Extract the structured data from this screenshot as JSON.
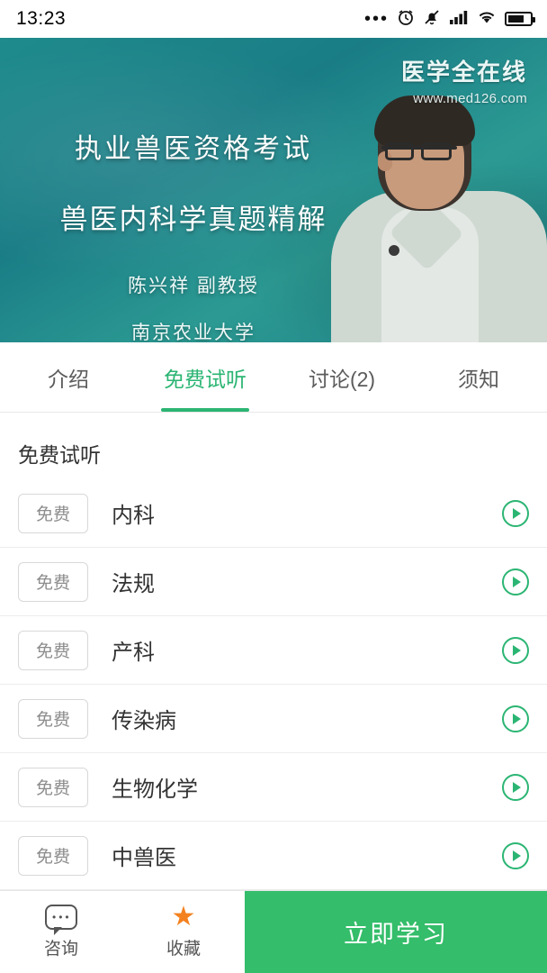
{
  "status_bar": {
    "time": "13:23",
    "icons": [
      "more-dots",
      "alarm-icon",
      "mute-bell-icon",
      "signal-icon",
      "wifi-icon",
      "battery-icon"
    ]
  },
  "hero": {
    "watermark_main": "医学全在线",
    "watermark_url": "www.med126.com",
    "title_line1": "执业兽医资格考试",
    "title_line2": "兽医内科学真题精解",
    "lecturer": "陈兴祥  副教授",
    "school": "南京农业大学"
  },
  "tabs": [
    {
      "label": "介绍",
      "active": false
    },
    {
      "label": "免费试听",
      "active": true
    },
    {
      "label": "讨论(2)",
      "active": false
    },
    {
      "label": "须知",
      "active": false
    }
  ],
  "section": {
    "title": "免费试听",
    "free_tag": "免费",
    "lessons": [
      {
        "name": "内科"
      },
      {
        "name": "法规"
      },
      {
        "name": "产科"
      },
      {
        "name": "传染病"
      },
      {
        "name": "生物化学"
      },
      {
        "name": "中兽医"
      }
    ]
  },
  "bottom_bar": {
    "consult_label": "咨询",
    "favorite_label": "收藏",
    "cta_label": "立即学习"
  },
  "colors": {
    "accent_green": "#2bb573",
    "cta_green": "#34bd6a",
    "star_orange": "#f4811f",
    "hero_teal": "#1f8b8c"
  }
}
